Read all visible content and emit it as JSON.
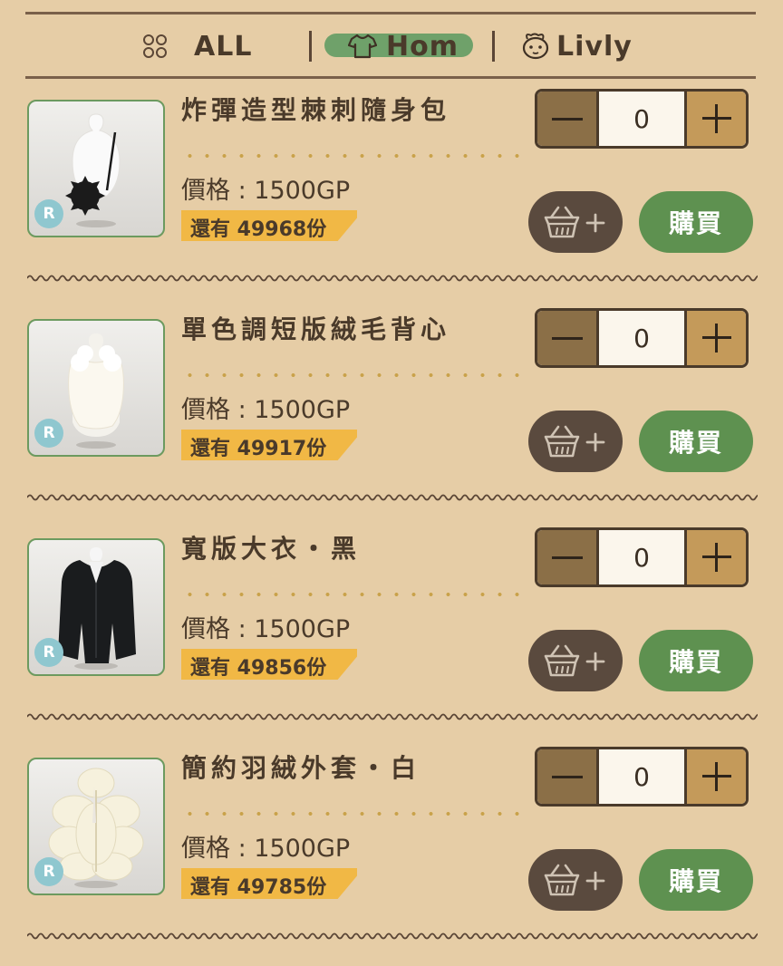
{
  "tabs": [
    {
      "label": "ALL",
      "icon": "grid-dots-icon",
      "active": false
    },
    {
      "label": "Hom",
      "icon": "shirt-icon",
      "active": true
    },
    {
      "label": "Livly",
      "icon": "livly-face-icon",
      "active": false
    }
  ],
  "items": [
    {
      "title": "炸彈造型棘刺隨身包",
      "price": "價格 : 1500GP",
      "stock": "還有 49968份",
      "qty": "0",
      "rarity": "R",
      "buy_label": "購買",
      "image": "spiked-bomb-bag-on-mannequin"
    },
    {
      "title": "單色調短版絨毛背心",
      "price": "價格 : 1500GP",
      "stock": "還有 49917份",
      "qty": "0",
      "rarity": "R",
      "buy_label": "購買",
      "image": "white-fluffy-vest-on-mannequin"
    },
    {
      "title": "寬版大衣・黑",
      "price": "價格 : 1500GP",
      "stock": "還有 49856份",
      "qty": "0",
      "rarity": "R",
      "buy_label": "購買",
      "image": "black-wide-coat-on-mannequin"
    },
    {
      "title": "簡約羽絨外套・白",
      "price": "價格 : 1500GP",
      "stock": "還有 49785份",
      "qty": "0",
      "rarity": "R",
      "buy_label": "購買",
      "image": "white-down-jacket-on-mannequin"
    }
  ],
  "colors": {
    "background": "#e6cda6",
    "buy_green": "#5e9150",
    "stock_yellow": "#f1b845",
    "cart_dark": "#5a4a3e",
    "thumb_border": "#6c9a5f",
    "rarity_badge": "#8fc7cf"
  }
}
